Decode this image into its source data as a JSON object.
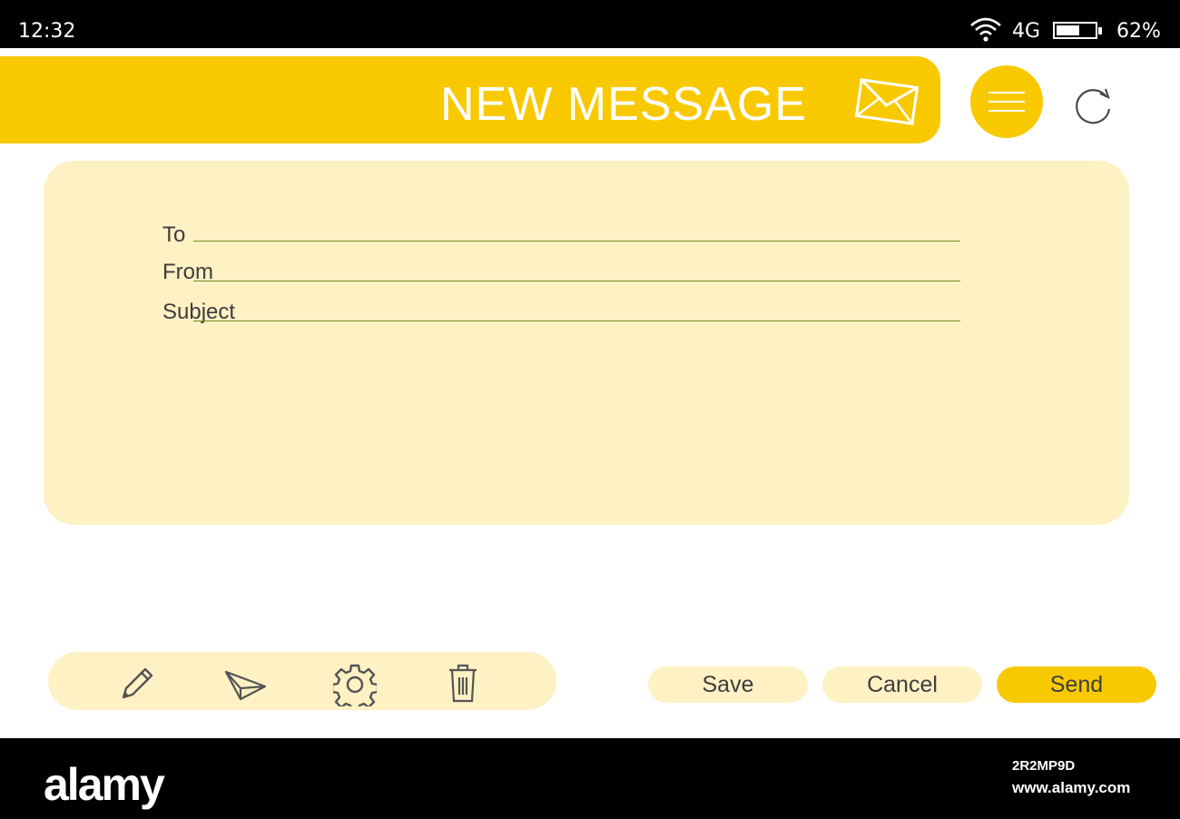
{
  "status_bar": {
    "time": "12:32",
    "network": "4G",
    "battery_percent_label": "62%",
    "battery_level": 0.62,
    "icons": [
      "wifi-icon",
      "battery-icon"
    ]
  },
  "header": {
    "title": "NEW MESSAGE",
    "icons": [
      "envelope-icon",
      "hamburger-menu-icon",
      "refresh-icon"
    ],
    "accent_color": "#f9c900"
  },
  "form": {
    "to_label": "To",
    "from_label": "From",
    "subject_label": "Subject",
    "to_value": "",
    "from_value": "",
    "subject_value": "",
    "background_color": "#fef1c4"
  },
  "toolbar": {
    "tools": [
      "pencil-icon",
      "paper-plane-icon",
      "gear-icon",
      "trash-icon"
    ]
  },
  "actions": {
    "save_label": "Save",
    "cancel_label": "Cancel",
    "send_label": "Send"
  },
  "footer": {
    "brand": "alamy",
    "image_id": "2R2MP9D",
    "site": "www.alamy.com"
  }
}
